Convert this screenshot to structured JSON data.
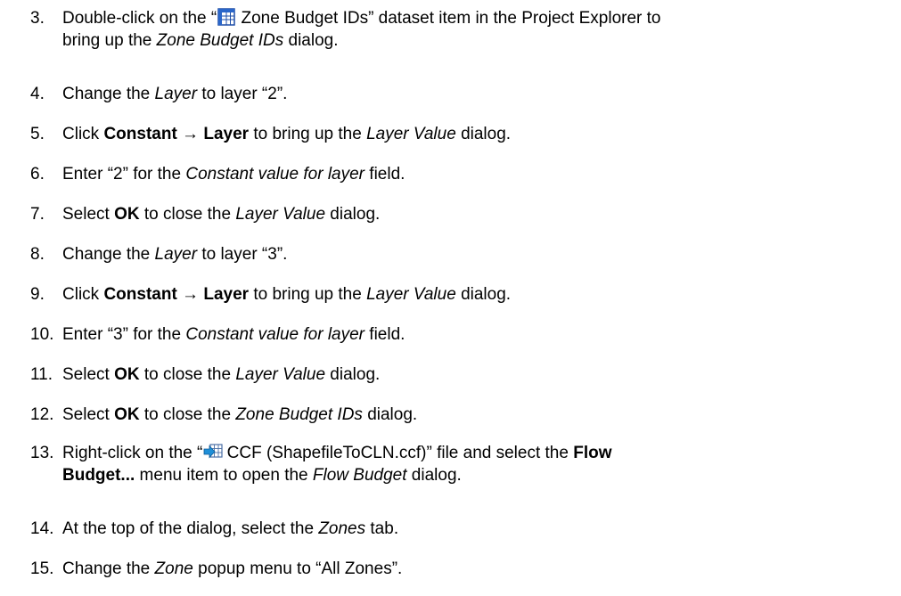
{
  "steps": [
    {
      "num": "3.",
      "wrap": true,
      "lines": [
        [
          {
            "t": "Double-click on the “"
          },
          {
            "icon": "dataset-grid-icon"
          },
          {
            "t": " Zone Budget IDs” dataset item in the Project Explorer to"
          }
        ],
        [
          {
            "t": "bring up the "
          },
          {
            "t": "Zone Budget IDs",
            "s": "i"
          },
          {
            "t": " dialog."
          }
        ]
      ]
    },
    {
      "num": "4.",
      "lines": [
        [
          {
            "t": "Change the "
          },
          {
            "t": "Layer",
            "s": "i"
          },
          {
            "t": " to layer “2”."
          }
        ]
      ]
    },
    {
      "num": "5.",
      "lines": [
        [
          {
            "t": "Click "
          },
          {
            "t": "Constant",
            "s": "b"
          },
          {
            "t": " → "
          },
          {
            "t": "Layer",
            "s": "b"
          },
          {
            "t": " to bring up the "
          },
          {
            "t": "Layer Value",
            "s": "i"
          },
          {
            "t": " dialog."
          }
        ]
      ]
    },
    {
      "num": "6.",
      "lines": [
        [
          {
            "t": "Enter “2” for the "
          },
          {
            "t": "Constant value for layer",
            "s": "i"
          },
          {
            "t": " field."
          }
        ]
      ]
    },
    {
      "num": "7.",
      "lines": [
        [
          {
            "t": "Select "
          },
          {
            "t": "OK",
            "s": "b"
          },
          {
            "t": " to close the "
          },
          {
            "t": "Layer Value",
            "s": "i"
          },
          {
            "t": " dialog."
          }
        ]
      ]
    },
    {
      "num": "8.",
      "lines": [
        [
          {
            "t": "Change the "
          },
          {
            "t": "Layer",
            "s": "i"
          },
          {
            "t": " to layer “3”."
          }
        ]
      ]
    },
    {
      "num": "9.",
      "lines": [
        [
          {
            "t": "Click "
          },
          {
            "t": "Constant",
            "s": "b"
          },
          {
            "t": " → "
          },
          {
            "t": "Layer",
            "s": "b"
          },
          {
            "t": " to bring up the "
          },
          {
            "t": "Layer Value",
            "s": "i"
          },
          {
            "t": " dialog."
          }
        ]
      ]
    },
    {
      "num": "10.",
      "wide": true,
      "lines": [
        [
          {
            "t": "Enter “3” for the "
          },
          {
            "t": "Constant value for layer",
            "s": "i"
          },
          {
            "t": " field."
          }
        ]
      ]
    },
    {
      "num": "11.",
      "wide": true,
      "lines": [
        [
          {
            "t": "Select "
          },
          {
            "t": "OK",
            "s": "b"
          },
          {
            "t": " to close the "
          },
          {
            "t": "Layer Value",
            "s": "i"
          },
          {
            "t": " dialog."
          }
        ]
      ]
    },
    {
      "num": "12.",
      "wide": true,
      "lines": [
        [
          {
            "t": "Select "
          },
          {
            "t": "OK",
            "s": "b"
          },
          {
            "t": " to close the "
          },
          {
            "t": "Zone Budget IDs",
            "s": "i"
          },
          {
            "t": " dialog."
          }
        ]
      ]
    },
    {
      "num": "13.",
      "wide": true,
      "wrap": true,
      "lines": [
        [
          {
            "t": "Right-click on the “"
          },
          {
            "icon": "ccf-file-icon"
          },
          {
            "t": " CCF (ShapefileToCLN.ccf)” file and select the "
          },
          {
            "t": "Flow",
            "s": "b"
          }
        ],
        [
          {
            "t": "Budget...",
            "s": "b"
          },
          {
            "t": " menu item to open the "
          },
          {
            "t": "Flow Budget",
            "s": "i"
          },
          {
            "t": " dialog."
          }
        ]
      ]
    },
    {
      "num": "14.",
      "wide": true,
      "lines": [
        [
          {
            "t": "At the top of the dialog, select the "
          },
          {
            "t": "Zones",
            "s": "i"
          },
          {
            "t": " tab."
          }
        ]
      ]
    },
    {
      "num": "15.",
      "wide": true,
      "lines": [
        [
          {
            "t": "Change the "
          },
          {
            "t": "Zone",
            "s": "i"
          },
          {
            "t": " popup menu to “All Zones”."
          }
        ]
      ]
    }
  ]
}
